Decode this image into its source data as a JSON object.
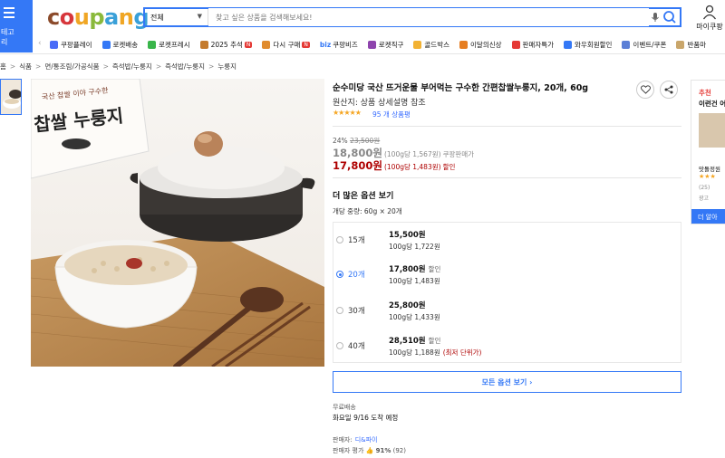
{
  "header": {
    "category_label": "테고\n리",
    "search_category": "전체",
    "search_placeholder": "찾고 싶은 상품을 검색해보세요!",
    "mypage_label": "마이쿠팡",
    "logo": [
      "c",
      "o",
      "u",
      "p",
      "a",
      "n",
      "g"
    ]
  },
  "nav": [
    {
      "label": "쿠팡플레이",
      "icon": "play-icon",
      "color": "#4a6cf7"
    },
    {
      "label": "로켓배송",
      "icon": "rocket-icon",
      "color": "#3478f6"
    },
    {
      "label": "로켓프레시",
      "icon": "rocket-fresh-icon",
      "color": "#39b54a"
    },
    {
      "label": "2025 추석",
      "icon": "chuseok-icon",
      "color": "#c47a2c",
      "new": "N"
    },
    {
      "label": "다시 구매",
      "icon": "rebuy-icon",
      "color": "#e08b2e",
      "new": "N"
    },
    {
      "label": "쿠팡비즈",
      "icon": "biz-icon",
      "color": "#3478f6",
      "prefix": "biz"
    },
    {
      "label": "로켓직구",
      "icon": "global-icon",
      "color": "#8e44ad"
    },
    {
      "label": "골드박스",
      "icon": "goldbox-icon",
      "color": "#f2b233"
    },
    {
      "label": "이달의신상",
      "icon": "new-products-icon",
      "color": "#e67e22"
    },
    {
      "label": "판매자특가",
      "icon": "seller-deal-icon",
      "color": "#e53935"
    },
    {
      "label": "와우회원할인",
      "icon": "wow-icon",
      "color": "#3478f6"
    },
    {
      "label": "이벤트/쿠폰",
      "icon": "event-icon",
      "color": "#5b7fd6"
    },
    {
      "label": "반품마",
      "icon": "return-icon",
      "color": "#c9a66b"
    }
  ],
  "breadcrumb": [
    "홈",
    "식품",
    "면/통조림/가공식품",
    "즉석밥/누룽지",
    "즉석밥/누룽지",
    "누룽지"
  ],
  "product": {
    "title": "순수미당 국산 뜨거운물 부어먹는 구수한 간편찹쌀누룽지, 20개, 60g",
    "origin": "원산지: 상품 상세설명 참조",
    "stars": "★★★★★",
    "rating_value": 4.5,
    "review_count": "95 개 상품평",
    "discount_rate": "24%",
    "original_price": "23,500원",
    "price": "18,800원",
    "price_unit": "(100g당 1,567원)",
    "price_note": "쿠팡판매가",
    "sale_price": "17,800원",
    "sale_unit": "(100g당 1,483원)",
    "sale_note": "할인"
  },
  "options": {
    "heading": "더 많은 옵션 보기",
    "unit_qty": "개당 중량: 60g × 20개",
    "items": [
      {
        "qty": "15개",
        "price": "15,500원",
        "tag": "",
        "per": "100g당 1,722원",
        "low": "",
        "selected": false
      },
      {
        "qty": "20개",
        "price": "17,800원",
        "tag": "할인",
        "per": "100g당 1,483원",
        "low": "",
        "selected": true
      },
      {
        "qty": "30개",
        "price": "25,800원",
        "tag": "",
        "per": "100g당 1,433원",
        "low": "",
        "selected": false
      },
      {
        "qty": "40개",
        "price": "28,510원",
        "tag": "할인",
        "per": "100g당 1,188원",
        "low": "(최저 단위가)",
        "selected": false
      }
    ],
    "all_button": "모든 옵션 보기 ›"
  },
  "shipping": {
    "label": "무료배송",
    "eta": "화요일 9/16 도착 예정"
  },
  "seller": {
    "label": "판매자:",
    "name": "디&파이",
    "rating_label": "판매자 평가",
    "rating": "91%",
    "rating_count": "(92)"
  },
  "side": {
    "tag": "추천",
    "title": "이런건 어",
    "name": "맛돌정원",
    "stars": "★★★",
    "count": "(25)",
    "ad": "광고",
    "button": "더 알아"
  },
  "image_text": {
    "box_top": "국산 찹쌀 이야 구수한",
    "box_main": "찹쌀 누룽지"
  }
}
